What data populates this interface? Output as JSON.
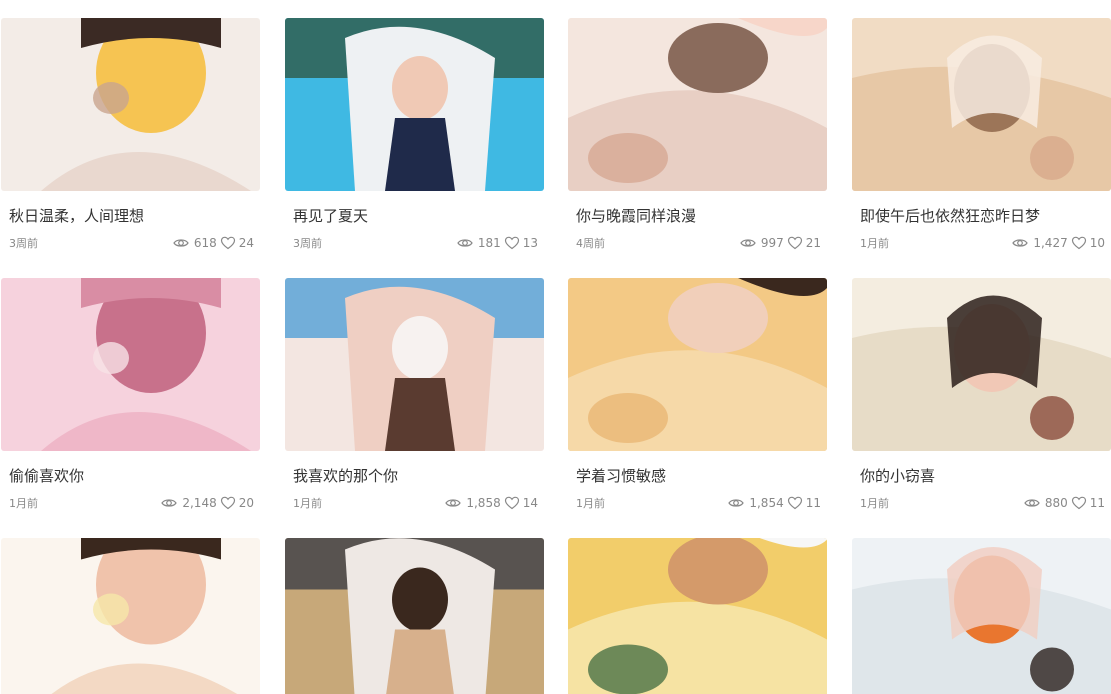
{
  "cards": [
    {
      "title": "秋日温柔，人间理想",
      "time": "3周前",
      "views": "618",
      "likes": "24",
      "photo": "portrait-star-fruit",
      "palette": [
        "#f3ece7",
        "#e9d8cf",
        "#c9a58f",
        "#3b2a24",
        "#f6c24a"
      ]
    },
    {
      "title": "再见了夏天",
      "time": "3周前",
      "views": "181",
      "likes": "13",
      "photo": "poolside-towel",
      "palette": [
        "#3fb9e3",
        "#eef1f3",
        "#2e4d32",
        "#f0c9b5",
        "#1f2a4a"
      ]
    },
    {
      "title": "你与晚霞同样浪漫",
      "time": "4周前",
      "views": "997",
      "likes": "21",
      "photo": "lace-flower",
      "palette": [
        "#f4e6de",
        "#e8cfc4",
        "#d6a590",
        "#f7d6c9",
        "#8a6b5c"
      ]
    },
    {
      "title": "即使午后也依然狂恋昨日梦",
      "time": "1月前",
      "views": "1,427",
      "likes": "10",
      "photo": "lace-dress",
      "palette": [
        "#f1dcc4",
        "#e7c8a6",
        "#d8a98b",
        "#f8ece2",
        "#9c7558"
      ]
    },
    {
      "title": "偷偷喜欢你",
      "time": "1月前",
      "views": "2,148",
      "likes": "20",
      "photo": "pink-ribbon",
      "palette": [
        "#f6d2dd",
        "#efb7c8",
        "#f8e2e6",
        "#d98da4",
        "#c56c86"
      ]
    },
    {
      "title": "我喜欢的那个你",
      "time": "1月前",
      "views": "1,858",
      "likes": "14",
      "photo": "starfish-portrait",
      "palette": [
        "#f3e6e1",
        "#efcfc3",
        "#3a95d6",
        "#f7f2f0",
        "#5a3b30"
      ]
    },
    {
      "title": "学着习惯敏感",
      "time": "1月前",
      "views": "1,854",
      "likes": "11",
      "photo": "crochet-top",
      "palette": [
        "#f3c985",
        "#f6d9a8",
        "#e8b471",
        "#3a281e",
        "#f1cfba"
      ]
    },
    {
      "title": "你的小窃喜",
      "time": "1月前",
      "views": "880",
      "likes": "11",
      "photo": "glasses-pillow",
      "palette": [
        "#f4ede0",
        "#e7dcc7",
        "#8b4c3c",
        "#2b1e1a",
        "#f1c8b6"
      ]
    },
    {
      "title": "",
      "time": "",
      "views": "",
      "likes": "",
      "photo": "sunny-window",
      "palette": [
        "#fbf5ee",
        "#f3d9c4",
        "#f6e7a9",
        "#3a281e",
        "#efc0a6"
      ]
    },
    {
      "title": "",
      "time": "",
      "views": "",
      "likes": "",
      "photo": "school-uniform-floor",
      "palette": [
        "#c7a879",
        "#eee8e4",
        "#2a2f3f",
        "#3a281e",
        "#d7b08c"
      ]
    },
    {
      "title": "",
      "time": "",
      "views": "",
      "likes": "",
      "photo": "yellow-bed",
      "palette": [
        "#f2cd6a",
        "#f6e3a3",
        "#3f6b3f",
        "#f7f7f7",
        "#d49a6a"
      ]
    },
    {
      "title": "",
      "time": "",
      "views": "",
      "likes": "",
      "photo": "ukulele-portrait",
      "palette": [
        "#eef2f5",
        "#dfe6ea",
        "#2b211d",
        "#f1cfc3",
        "#e9762f"
      ]
    }
  ]
}
